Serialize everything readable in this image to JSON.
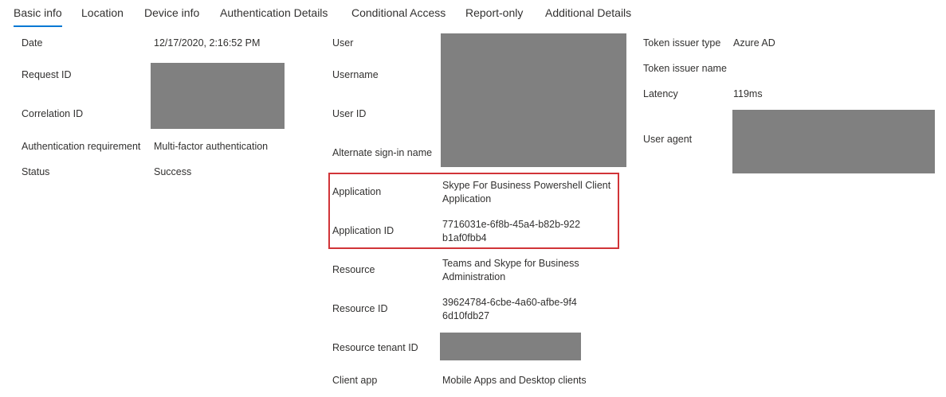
{
  "tabs": [
    {
      "label": "Basic info",
      "active": true
    },
    {
      "label": "Location"
    },
    {
      "label": "Device info"
    },
    {
      "label": "Authentication Details"
    },
    {
      "label": "Conditional Access"
    },
    {
      "label": "Report-only"
    },
    {
      "label": "Additional Details"
    }
  ],
  "col1": {
    "date": {
      "label": "Date",
      "value": "12/17/2020, 2:16:52 PM"
    },
    "request_id": {
      "label": "Request ID"
    },
    "correlation_id": {
      "label": "Correlation ID"
    },
    "auth_requirement": {
      "label": "Authentication requirement",
      "value": "Multi-factor authentication"
    },
    "status": {
      "label": "Status",
      "value": "Success"
    }
  },
  "col2": {
    "user": {
      "label": "User"
    },
    "username": {
      "label": "Username"
    },
    "user_id": {
      "label": "User ID"
    },
    "alternate_signin": {
      "label": "Alternate sign-in name"
    },
    "application": {
      "label": "Application",
      "value": "Skype For Business Powershell Client Application"
    },
    "application_id": {
      "label": "Application ID",
      "value": "7716031e-6f8b-45a4-b82b-922b1af0fbb4"
    },
    "resource": {
      "label": "Resource",
      "value": "Teams and Skype for Business Administration"
    },
    "resource_id": {
      "label": "Resource ID",
      "value": "39624784-6cbe-4a60-afbe-9f46d10fdb27"
    },
    "resource_tenant_id": {
      "label": "Resource tenant ID"
    },
    "client_app": {
      "label": "Client app",
      "value": "Mobile Apps and Desktop clients"
    }
  },
  "col3": {
    "token_issuer_type": {
      "label": "Token issuer type",
      "value": "Azure AD"
    },
    "token_issuer_name": {
      "label": "Token issuer name"
    },
    "latency": {
      "label": "Latency",
      "value": "119ms"
    },
    "user_agent": {
      "label": "User agent"
    }
  },
  "colors": {
    "accent": "#0078d4",
    "highlight": "#d13438",
    "redaction": "#808080"
  }
}
